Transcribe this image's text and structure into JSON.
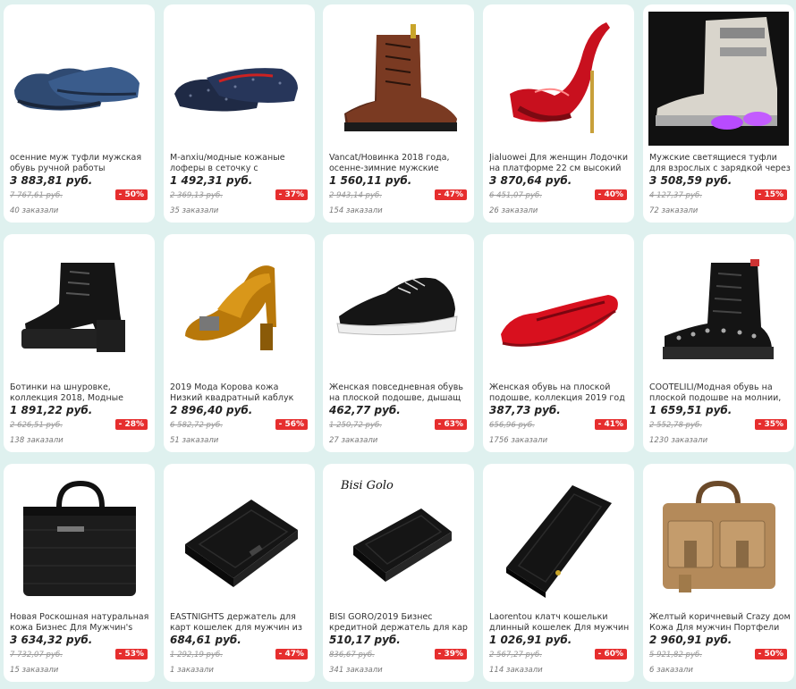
{
  "products": [
    {
      "title": "осенние муж туфли мужская обувь ручной работы",
      "price": "3 883,81 руб.",
      "old_price": "7 767,61 руб.",
      "discount": "- 50%",
      "orders": "40 заказали",
      "icon": "blue-oxford-shoes-icon"
    },
    {
      "title": "M-anxiu/модные кожаные лоферы в сеточку с",
      "price": "1 492,31 руб.",
      "old_price": "2 369,13 руб.",
      "discount": "- 37%",
      "orders": "35 заказали",
      "icon": "glitter-loafers-icon"
    },
    {
      "title": "Vancat/Новинка 2018 года, осенне-зимние мужские",
      "price": "1 560,11 руб.",
      "old_price": "2 943,14 руб.",
      "discount": "- 47%",
      "orders": "154 заказали",
      "icon": "brown-boot-icon"
    },
    {
      "title": "Jialuowei Для женщин Лодочки на платформе 22 см высокий",
      "price": "3 870,64 руб.",
      "old_price": "6 451,07 руб.",
      "discount": "- 40%",
      "orders": "26 заказали",
      "icon": "red-high-heel-icon"
    },
    {
      "title": "Мужские светящиеся туфли для взрослых с зарядкой через us",
      "price": "3 508,59 руб.",
      "old_price": "4 127,37 руб.",
      "discount": "- 15%",
      "orders": "72 заказали",
      "icon": "led-sneaker-icon"
    },
    {
      "title": "Ботинки на шнуровке, коллекция 2018, Модные",
      "price": "1 891,22 руб.",
      "old_price": "2 626,51 руб.",
      "discount": "- 28%",
      "orders": "138 заказали",
      "icon": "black-platform-boot-icon"
    },
    {
      "title": "2019 Мода Корова кожа Низкий квадратный каблук Большие",
      "price": "2 896,40 руб.",
      "old_price": "6 582,72 руб.",
      "discount": "- 56%",
      "orders": "51 заказали",
      "icon": "yellow-pump-icon"
    },
    {
      "title": "Женская повседневная обувь на плоской подошве, дышащ",
      "price": "462,77 руб.",
      "old_price": "1 250,72 руб.",
      "discount": "- 63%",
      "orders": "27 заказали",
      "icon": "black-sneaker-icon"
    },
    {
      "title": "Женская обувь на плоской подошве, коллекция 2019 год",
      "price": "387,73 руб.",
      "old_price": "656,96 руб.",
      "discount": "- 41%",
      "orders": "1756 заказали",
      "icon": "red-flat-icon"
    },
    {
      "title": "COOTELILI/Модная обувь на плоской подошве на молнии,",
      "price": "1 659,51 руб.",
      "old_price": "2 552,78 руб.",
      "discount": "- 35%",
      "orders": "1230 заказали",
      "icon": "studded-boot-icon"
    },
    {
      "title": "Новая Роскошная натуральная кожа Бизнес Для Мужчин's",
      "price": "3 634,32 руб.",
      "old_price": "7 732,07 руб.",
      "discount": "- 53%",
      "orders": "15 заказали",
      "icon": "black-briefcase-icon"
    },
    {
      "title": "EASTNIGHTS держатель для карт кошелек для мужчин из",
      "price": "684,61 руб.",
      "old_price": "1 292,19 руб.",
      "discount": "- 47%",
      "orders": "1 заказали",
      "icon": "card-holder-icon"
    },
    {
      "title": "BISI GORO/2019 Бизнес кредитной держатель для кар",
      "price": "510,17 руб.",
      "old_price": "836,67 руб.",
      "discount": "- 39%",
      "orders": "341 заказали",
      "icon": "black-wallet-icon",
      "brand_watermark": "Bisi Golo"
    },
    {
      "title": "Laorentou клатч кошельки длинный кошелек Для мужчин",
      "price": "1 026,91 руб.",
      "old_price": "2 567,27 руб.",
      "discount": "- 60%",
      "orders": "114 заказали",
      "icon": "long-wallet-icon"
    },
    {
      "title": "Желтый коричневый Crazy дом Кожа Для мужчин Портфели",
      "price": "2 960,91 руб.",
      "old_price": "5 921,82 руб.",
      "discount": "- 50%",
      "orders": "6 заказали",
      "icon": "tan-messenger-bag-icon"
    }
  ],
  "colors": {
    "background": "#dff1ef",
    "discount": "#e62e2e",
    "card": "#ffffff"
  }
}
